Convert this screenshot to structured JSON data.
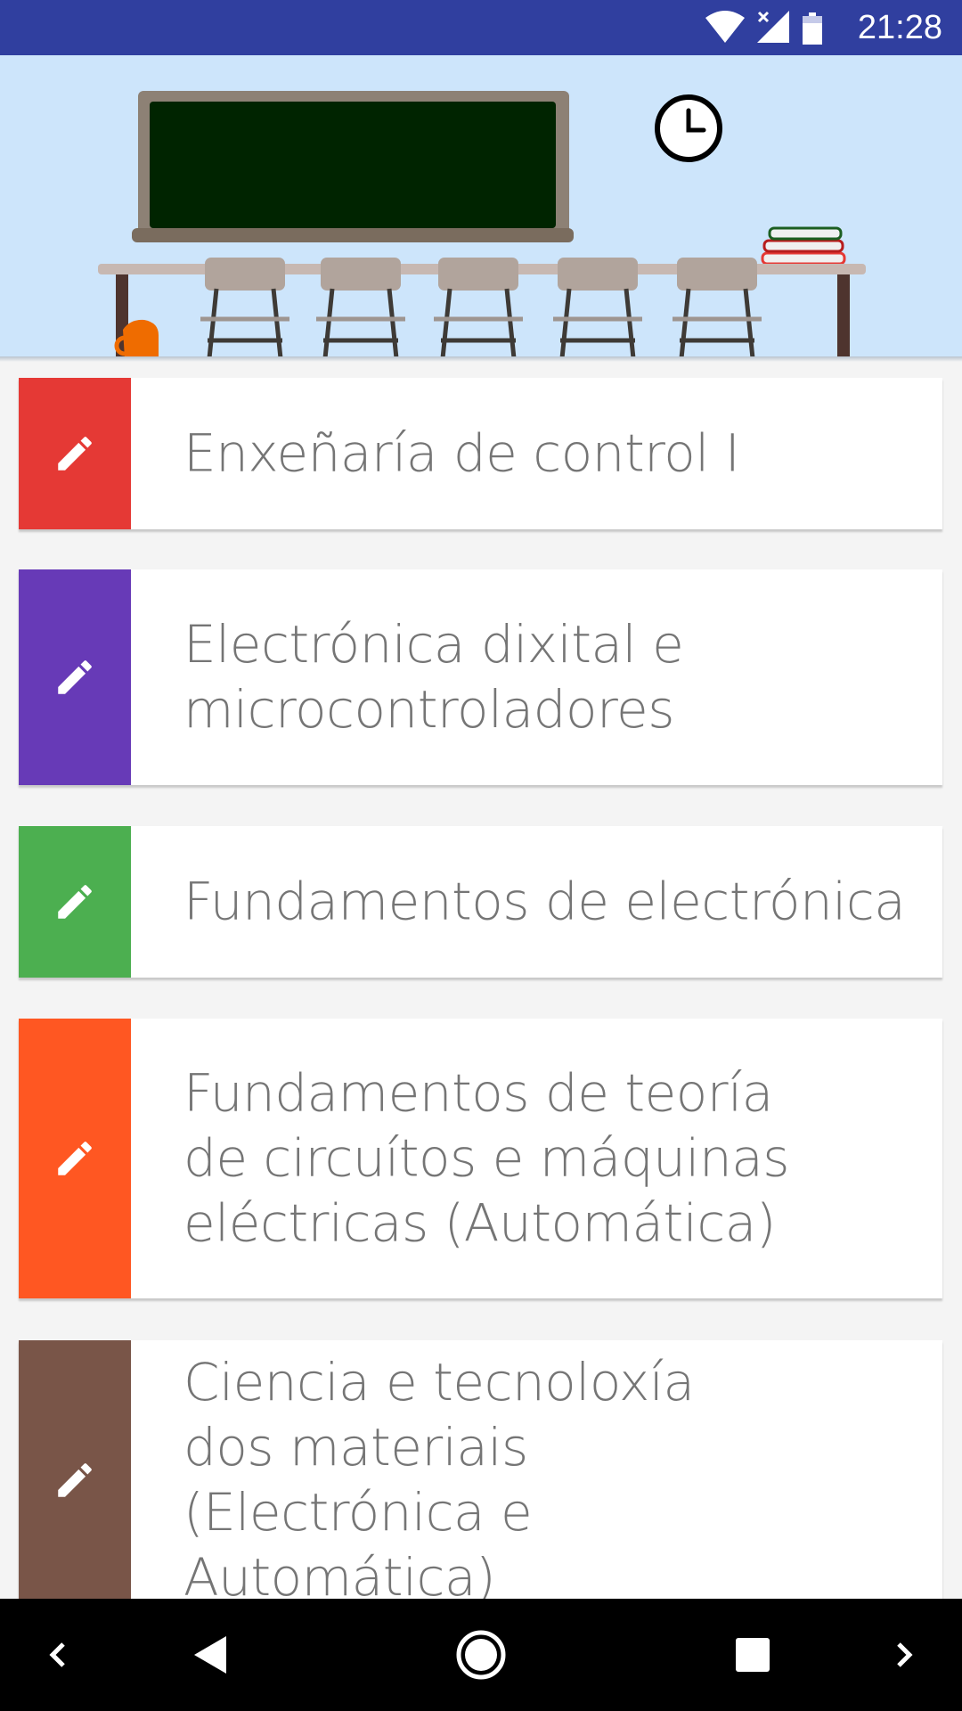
{
  "status_bar": {
    "time": "21:28",
    "icons": [
      "wifi-icon",
      "signal-no-data-icon",
      "battery-icon"
    ],
    "color": "#303f9f"
  },
  "header": {
    "illustration": "classroom-illustration",
    "background": "#cde5fb"
  },
  "courses": [
    {
      "title": "Enxeñaría de control I",
      "color": "#e53935",
      "icon": "pencil-icon"
    },
    {
      "title": "Electrónica dixital e microcontroladores",
      "color": "#673ab7",
      "icon": "pencil-icon"
    },
    {
      "title": "Fundamentos de electrónica",
      "color": "#4caf50",
      "icon": "pencil-icon"
    },
    {
      "title": "Fundamentos de teoría de circuítos e máquinas eléctricas (Automática)",
      "color": "#ff5722",
      "icon": "pencil-icon"
    },
    {
      "title": "Ciencia e tecnoloxía dos materiais (Electrónica e Automática)",
      "color": "#795548",
      "icon": "pencil-icon"
    }
  ],
  "nav_bar": {
    "buttons": [
      "chevron-left-icon",
      "back-icon",
      "home-icon",
      "recents-icon",
      "chevron-right-icon"
    ]
  }
}
